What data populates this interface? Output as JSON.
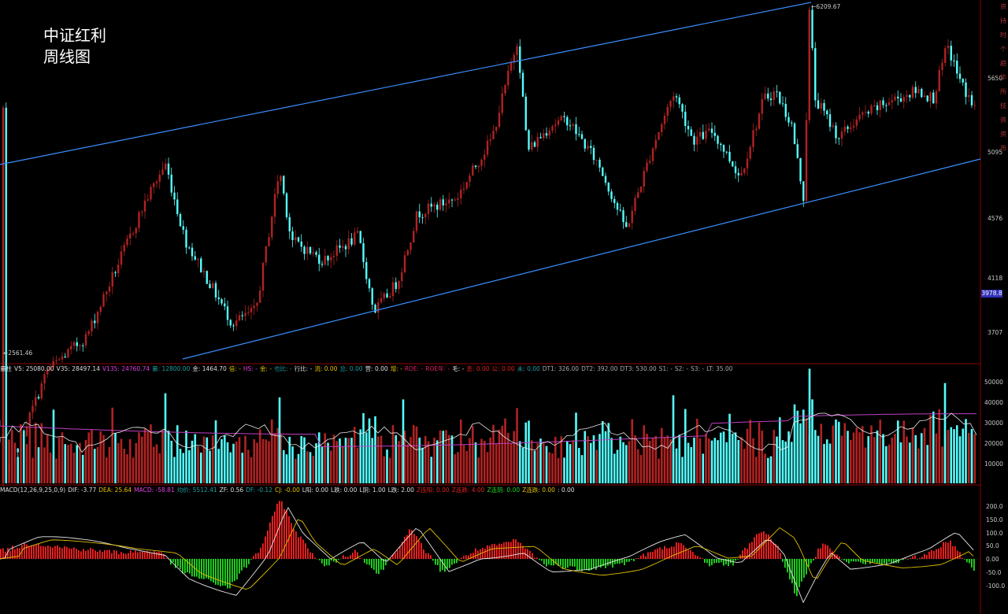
{
  "title": {
    "line1": "中证红利",
    "line2": "周线图"
  },
  "price_panel": {
    "axis_labels": [
      "5650",
      "5095",
      "4576",
      "4118",
      "3707"
    ],
    "high_label": "6209.67",
    "low_label": "2561.46",
    "current_price_badge": "3978.8",
    "right_strip_chars": [
      "资",
      "持",
      "时",
      "个",
      "趋",
      "华",
      "所",
      "技",
      "资",
      "资",
      "市"
    ]
  },
  "volume_panel": {
    "info": [
      {
        "text": "量柱",
        "color": "#dddddd"
      },
      {
        "text": "V5: 25080.00",
        "color": "#dddddd"
      },
      {
        "text": "V35: 28497.14",
        "color": "#dddddd"
      },
      {
        "text": "V135: 24760.74",
        "color": "#e040e0"
      },
      {
        "text": "量: 12800.00",
        "color": "#1e9e9e"
      },
      {
        "text": "金: 1464.70",
        "color": "#dddddd"
      },
      {
        "text": "倍: -",
        "color": "#e0c000"
      },
      {
        "text": "HS: -",
        "color": "#e040e0"
      },
      {
        "text": "金: -",
        "color": "#e0c000"
      },
      {
        "text": "也比: -",
        "color": "#1e9e9e"
      },
      {
        "text": "行比: -",
        "color": "#dddddd"
      },
      {
        "text": "流: 0.00",
        "color": "#e0c000"
      },
      {
        "text": "总: 0.00",
        "color": "#1e9e9e"
      },
      {
        "text": "营: 0.00",
        "color": "#dddddd"
      },
      {
        "text": "增: -",
        "color": "#e0c000"
      },
      {
        "text": "ROE: -",
        "color": "#e02060"
      },
      {
        "text": "ROE年: -",
        "color": "#e02060"
      },
      {
        "text": "毛: -",
        "color": "#dddddd"
      },
      {
        "text": "息: 0.00",
        "color": "#e02020"
      },
      {
        "text": "公: 0.00",
        "color": "#e02020"
      },
      {
        "text": "未: 0.00",
        "color": "#1e9e9e"
      },
      {
        "text": "DT1: 326.00",
        "color": "#aaaaaa"
      },
      {
        "text": "DT2: 392.00",
        "color": "#aaaaaa"
      },
      {
        "text": "DT3: 530.00",
        "color": "#aaaaaa"
      },
      {
        "text": "S1: -",
        "color": "#aaaaaa"
      },
      {
        "text": "S2: -",
        "color": "#aaaaaa"
      },
      {
        "text": "S3: -",
        "color": "#aaaaaa"
      },
      {
        "text": "LT: 35.00",
        "color": "#aaaaaa"
      }
    ],
    "axis_labels": [
      "50000",
      "40000",
      "30000",
      "20000",
      "10000"
    ]
  },
  "macd_panel": {
    "info": [
      {
        "text": "MACD(12,26,9,25,0,9)",
        "color": "#dddddd"
      },
      {
        "text": "DIF: -3.77",
        "color": "#dddddd"
      },
      {
        "text": "DEA: 25.64",
        "color": "#e0c000"
      },
      {
        "text": "MACD: -58.81",
        "color": "#e040e0"
      },
      {
        "text": "均价: 5512.41",
        "color": "#1e9e9e"
      },
      {
        "text": "ZF: 0.56",
        "color": "#dddddd"
      },
      {
        "text": "DF: -0.12",
        "color": "#1e9e9e"
      },
      {
        "text": "CJ: -0.00",
        "color": "#e0c000"
      },
      {
        "text": "L阳: 0.00",
        "color": "#dddddd"
      },
      {
        "text": "L跌: 0.00",
        "color": "#dddddd"
      },
      {
        "text": "L阴: 1.00",
        "color": "#dddddd"
      },
      {
        "text": "L跌: 2.00",
        "color": "#dddddd"
      },
      {
        "text": "Z连阳: 0.00",
        "color": "#e02020"
      },
      {
        "text": "Z连跌: 4.00",
        "color": "#e02020"
      },
      {
        "text": "Z连阴: 0.00",
        "color": "#20d020"
      },
      {
        "text": "Z连跌: 0.00",
        "color": "#e0c000"
      },
      {
        "text": ": 0.00",
        "color": "#dddddd"
      }
    ],
    "axis_labels": [
      "200.0",
      "150.0",
      "100.0",
      "50.0",
      "0.00",
      "-50.0",
      "-100.0"
    ]
  },
  "colors": {
    "up": "#b22222",
    "down": "#54ffff",
    "channel": "#3a8fff",
    "panel_border": "#8b0000",
    "macd_pos": "#ff2020",
    "macd_neg": "#22dd22",
    "dif": "#e8e8e8",
    "dea": "#e0c000",
    "vol_ma_long": "#c040c0",
    "vol_ma_short": "#e8e8e8"
  }
}
